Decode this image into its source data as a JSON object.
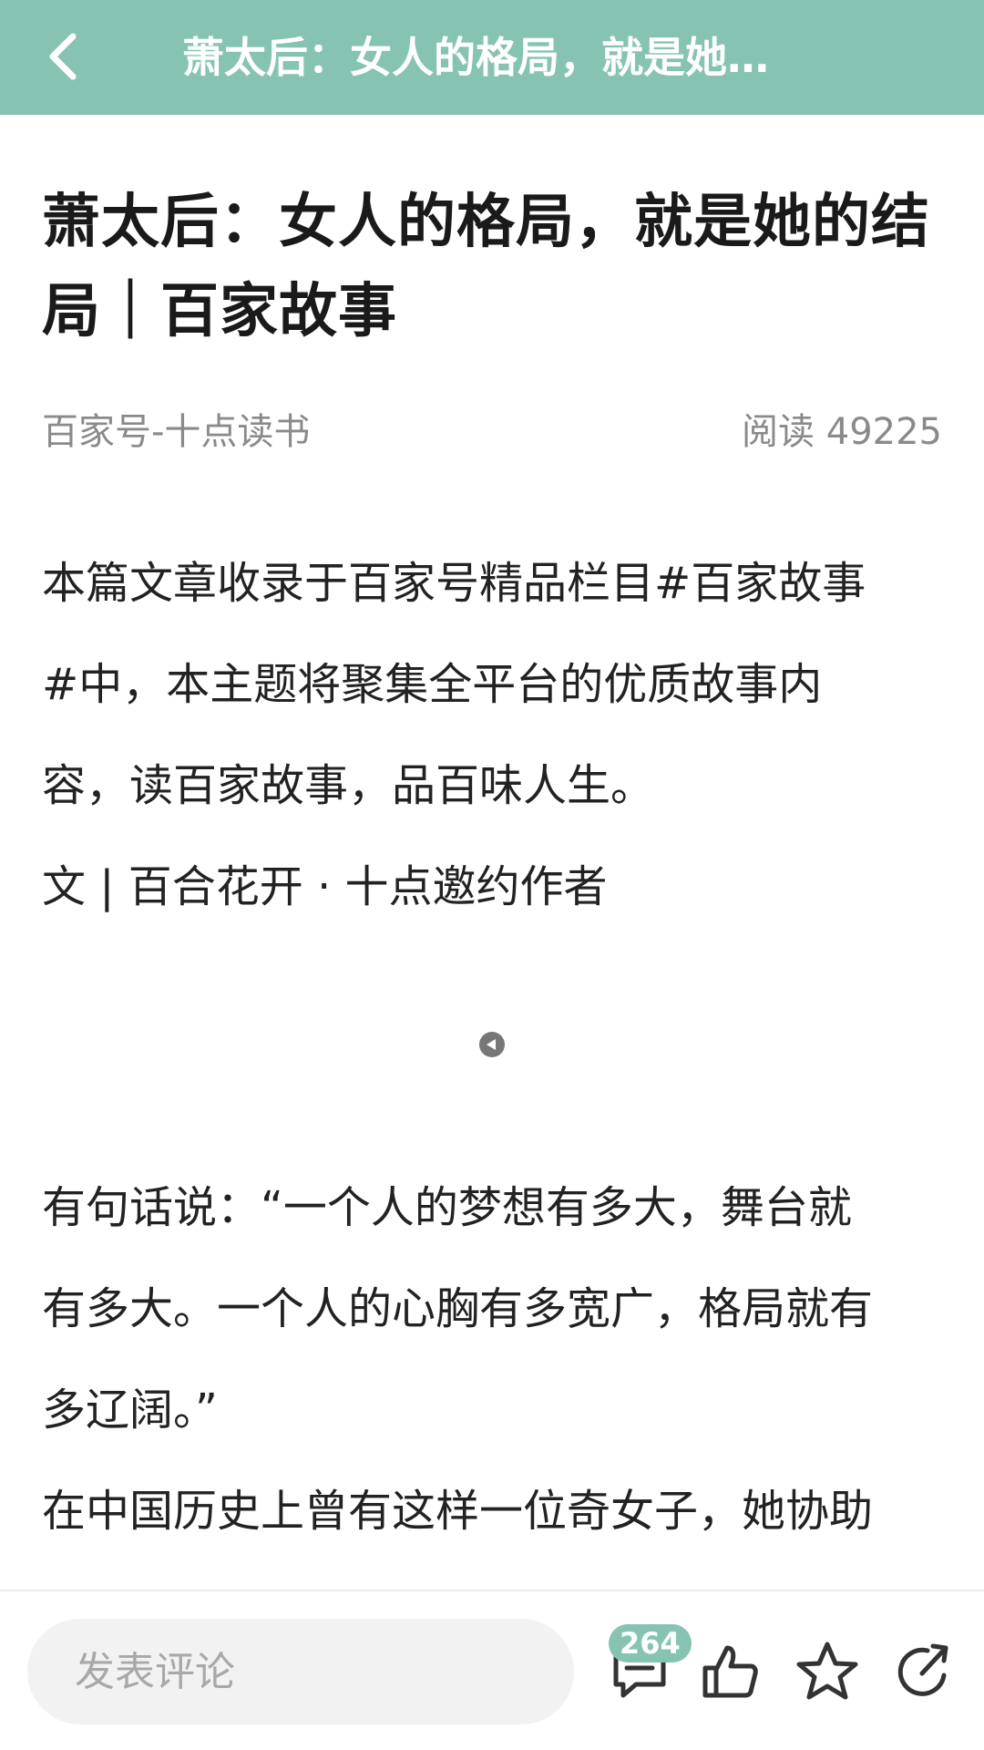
{
  "header": {
    "back_icon": "chevron-left-icon",
    "title": "萧太后：女人的格局，就是她的结局｜百家故事",
    "accent_color": "#86c3b3"
  },
  "article": {
    "title": "萧太后：女人的格局，就是她的结局｜百家故事",
    "source": "百家号-十点读书",
    "read_count": "阅读 49225",
    "intro_lines": [
      "本篇文章收录于百家号精品栏目#百家故事",
      "#中，本主题将聚集全平台的优质故事内",
      "容，读百家故事，品百味人生。",
      "文 | 百合花开 · 十点邀约作者"
    ],
    "body_lines": [
      "有句话说：“一个人的梦想有多大，舞台就",
      "有多大。一个人的心胸有多宽广，格局就有",
      "多辽阔。”",
      "在中国历史上曾有这样一位奇女子，她协助"
    ]
  },
  "bottom_bar": {
    "comment_placeholder": "发表评论",
    "comment_count": "264",
    "icons": [
      "comment-icon",
      "thumbs-up-icon",
      "star-icon",
      "share-icon"
    ]
  }
}
